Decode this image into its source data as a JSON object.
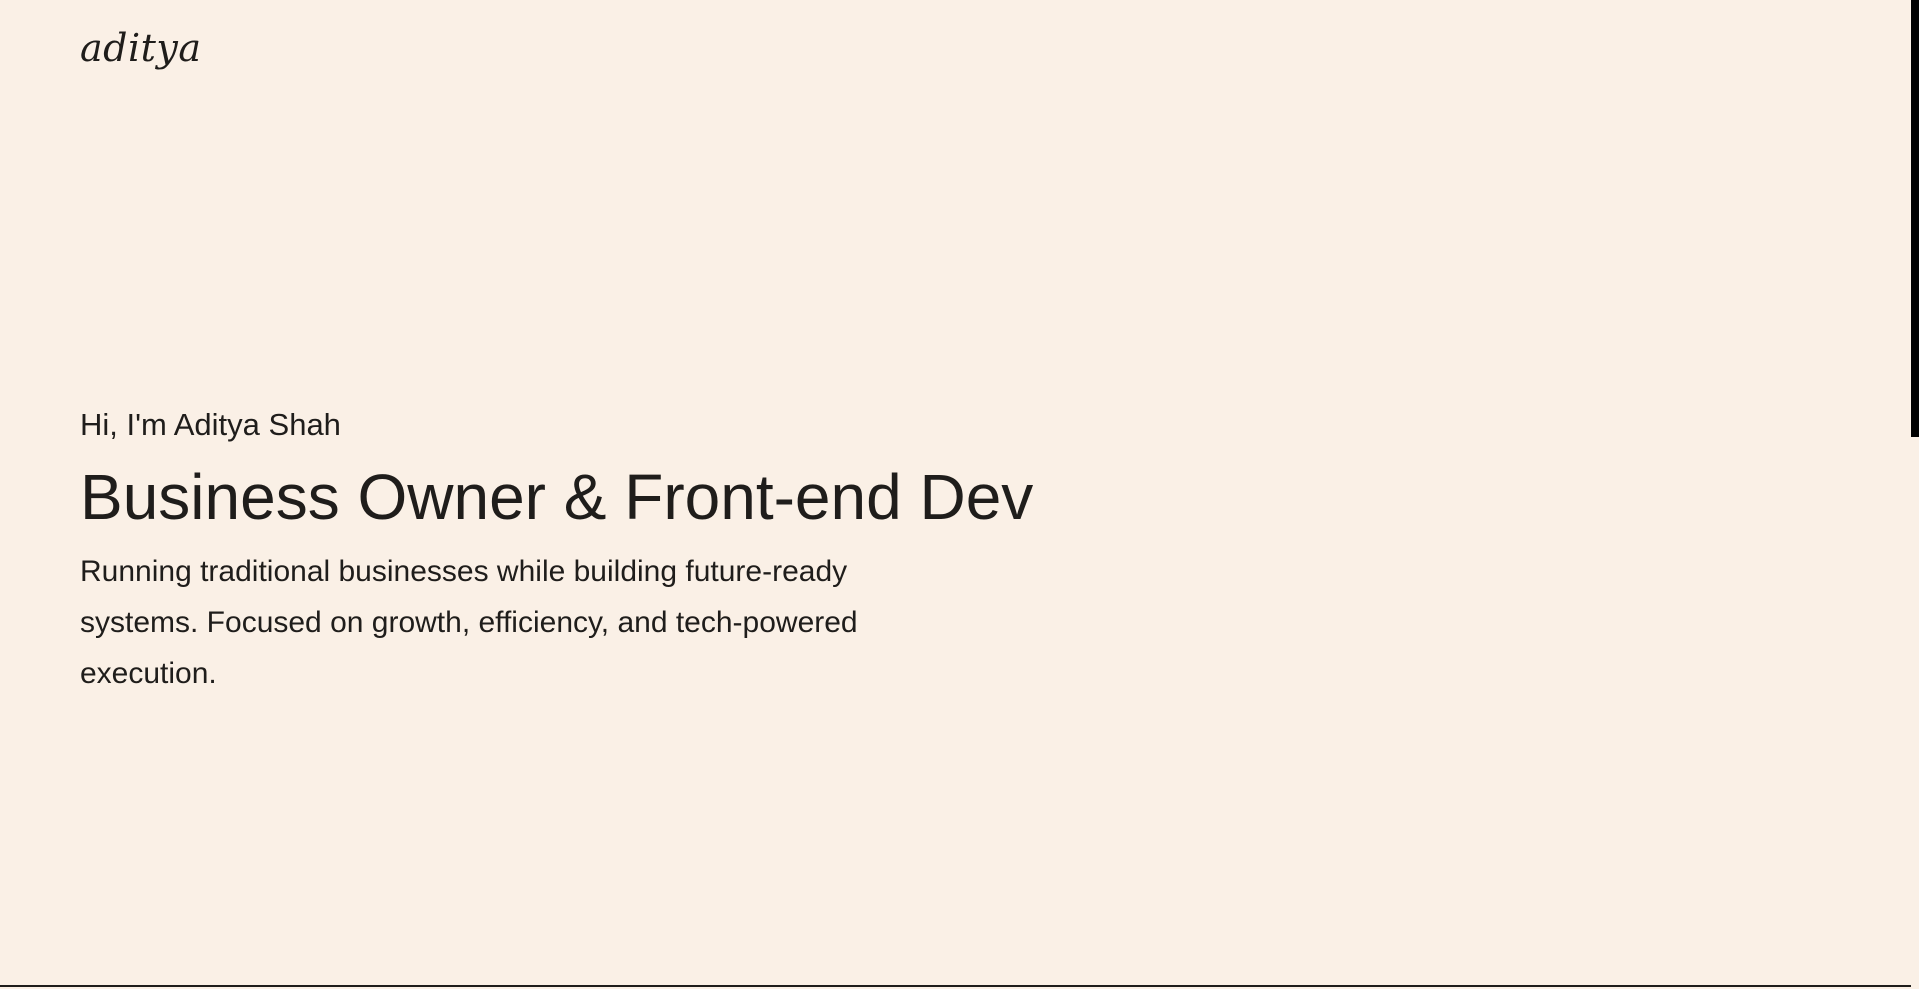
{
  "header": {
    "logo_text": "aditya"
  },
  "hero": {
    "greeting": "Hi, I'm Aditya Shah",
    "headline": "Business Owner & Front-end Dev",
    "description": "Running traditional businesses while building future-ready systems. Focused on growth, efficiency, and tech-powered execution."
  },
  "colors": {
    "background": "#faf0e6",
    "text": "#1f1d1b",
    "scrollbar_thumb": "#000000"
  }
}
